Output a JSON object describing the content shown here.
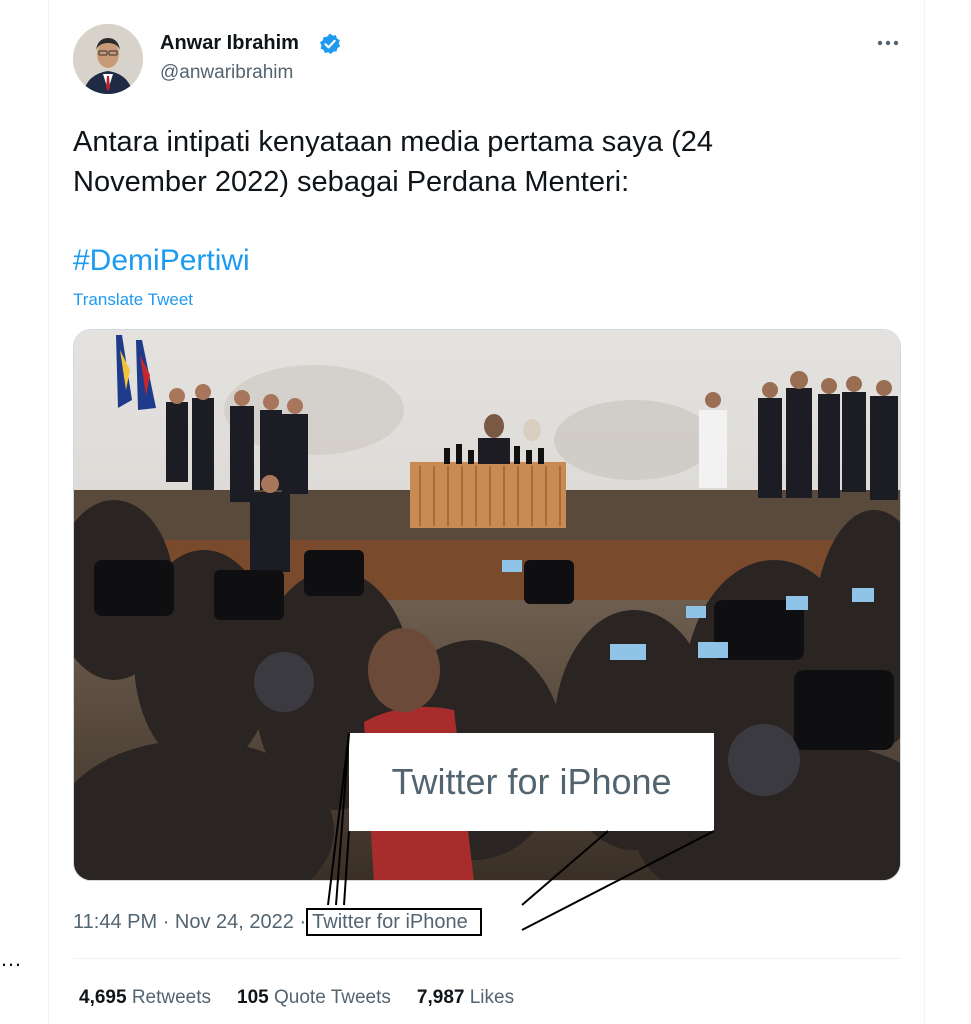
{
  "author": {
    "name": "Anwar Ibrahim",
    "handle": "@anwaribrahim"
  },
  "tweet": {
    "text": "Antara intipati kenyataan media pertama saya (24\nNovember 2022) sebagai Perdana Menteri:",
    "hashtag": "#DemiPertiwi",
    "translate_label": "Translate Tweet"
  },
  "callout": {
    "text": "Twitter for iPhone"
  },
  "meta": {
    "time": "11:44 PM",
    "separator": "·",
    "date": "Nov 24, 2022",
    "source": "Twitter for iPhone"
  },
  "stats": {
    "retweets_count": "4,695",
    "retweets_label": "Retweets",
    "quotes_count": "105",
    "quotes_label": "Quote Tweets",
    "likes_count": "7,987",
    "likes_label": "Likes"
  },
  "colors": {
    "accent": "#1d9bf0",
    "secondary_text": "#536471",
    "primary_text": "#0f1419"
  },
  "icons": {
    "verified": "verified-badge-icon",
    "more": "more-options-icon"
  }
}
